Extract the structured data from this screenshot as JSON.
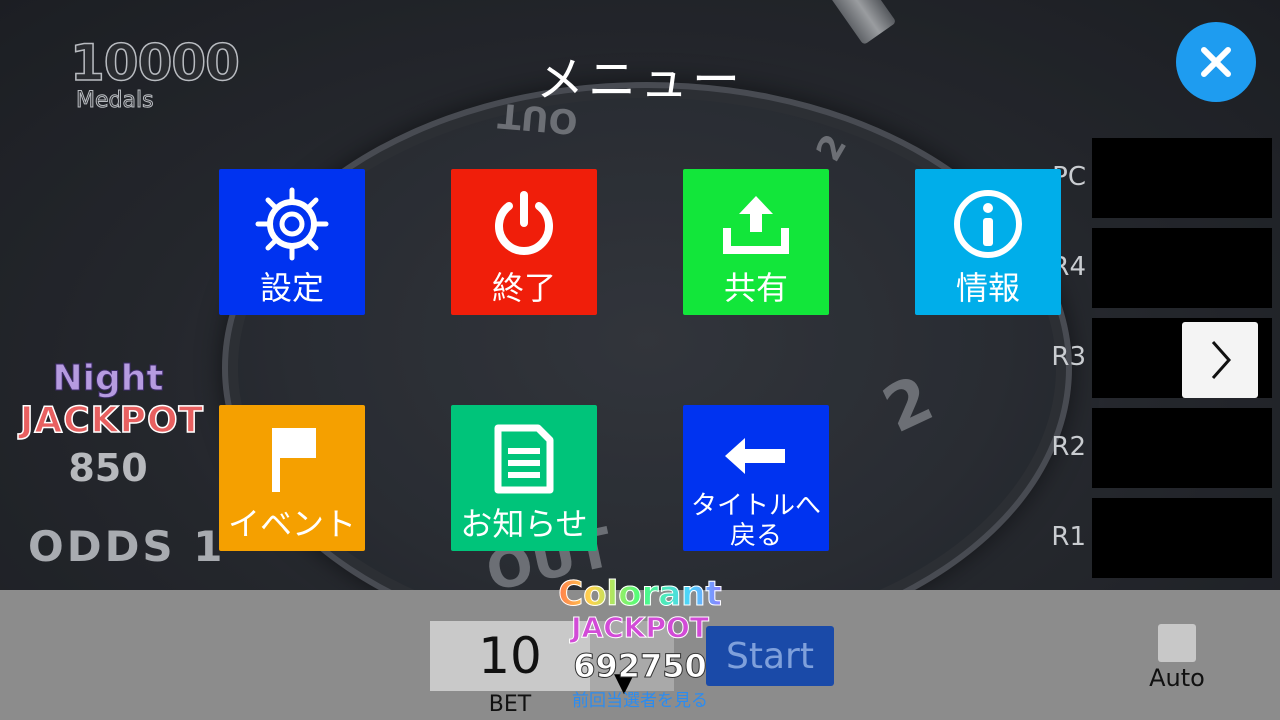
{
  "header": {
    "medals_value": "10000",
    "medals_label": "Medals",
    "menu_title": "メニュー",
    "close_icon": "close-icon"
  },
  "wheel_marks": {
    "out_top": "OUT",
    "num_top_right": "2",
    "num_right": "2",
    "out_bottom": "OUT"
  },
  "menu_tiles": [
    {
      "label": "設定",
      "icon": "gear-icon",
      "color": "#0033f0"
    },
    {
      "label": "終了",
      "icon": "power-icon",
      "color": "#f01e0a"
    },
    {
      "label": "共有",
      "icon": "upload-icon",
      "color": "#12e63a"
    },
    {
      "label": "情報",
      "icon": "info-icon",
      "color": "#00aeea"
    },
    {
      "label": "イベント",
      "icon": "flag-icon",
      "color": "#f5a000"
    },
    {
      "label": "お知らせ",
      "icon": "document-icon",
      "color": "#00c47a"
    },
    {
      "label": "タイトルへ戻る",
      "label_line1": "タイトルへ",
      "label_line2": "戻る",
      "icon": "arrow-left-icon",
      "color": "#0033f0"
    }
  ],
  "rank_panel": {
    "labels": [
      "PC",
      "R4",
      "R3",
      "R2",
      "R1"
    ],
    "next_icon": "chevron-right-icon"
  },
  "night_jackpot": {
    "title": "Night",
    "label": "JACKPOT",
    "value": "850",
    "odds": "ODDS 1"
  },
  "colorant_jackpot": {
    "title": "Colorant",
    "label": "JACKPOT",
    "value": "692750",
    "prev_winner_link": "前回当選者を見る"
  },
  "bottom_bar": {
    "bet_value": "10",
    "bet_label": "BET",
    "start_label": "Start",
    "auto_label": "Auto"
  }
}
